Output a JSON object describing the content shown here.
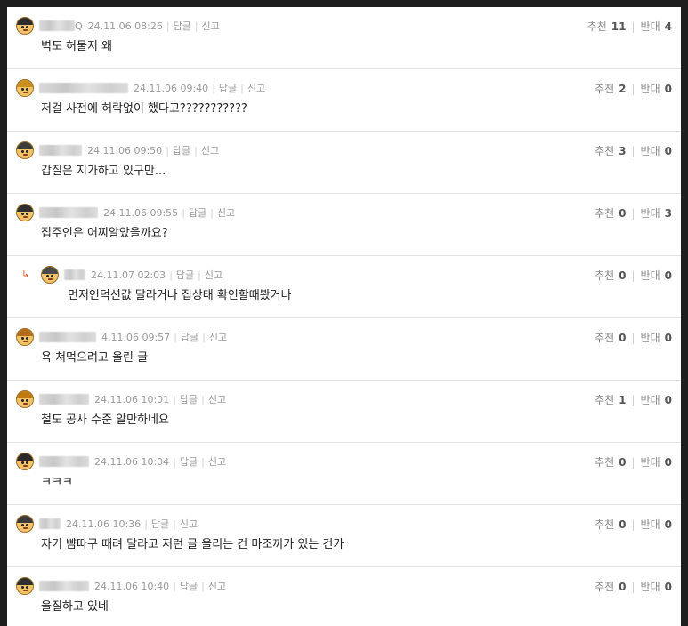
{
  "actions": {
    "reply": "답글",
    "report": "신고",
    "recommend": "추천",
    "oppose": "반대"
  },
  "reply_marker": "↳",
  "comments": [
    {
      "date": "24.11.06 08:26",
      "body": "벽도 허물지 왜",
      "up": "11",
      "down": "4",
      "reply": false,
      "hair": "#2b2b2b",
      "nick_w": 40,
      "nick_suffix": "Q"
    },
    {
      "date": "24.11.06 09:40",
      "body": "저걸 사전에 허락없이 했다고???????????",
      "up": "2",
      "down": "0",
      "reply": false,
      "hair": "#c9901e",
      "nick_w": 100,
      "nick_suffix": ""
    },
    {
      "date": "24.11.06 09:50",
      "body": "갑질은 지가하고 있구만...",
      "up": "3",
      "down": "0",
      "reply": false,
      "hair": "#3b3b3b",
      "nick_w": 48,
      "nick_suffix": ""
    },
    {
      "date": "24.11.06 09:55",
      "body": "집주인은 어찌알았을까요?",
      "up": "0",
      "down": "3",
      "reply": false,
      "hair": "#2f2f2f",
      "nick_w": 66,
      "nick_suffix": ""
    },
    {
      "date": "24.11.07 02:03",
      "body": "먼저인덕션값 달라거나 집상태 확인할때봤거나",
      "up": "0",
      "down": "0",
      "reply": true,
      "hair": "#4a4a4a",
      "nick_w": 24,
      "nick_suffix": ""
    },
    {
      "date": "4.11.06 09:57",
      "body": "욕 쳐먹으려고 올린 글",
      "up": "0",
      "down": "0",
      "reply": false,
      "hair": "#b36d1b",
      "nick_w": 64,
      "nick_suffix": ""
    },
    {
      "date": "24.11.06 10:01",
      "body": "철도 공사 수준 알만하네요",
      "up": "1",
      "down": "0",
      "reply": false,
      "hair": "#c07a12",
      "nick_w": 56,
      "nick_suffix": ""
    },
    {
      "date": "24.11.06 10:04",
      "body": "ㅋㅋㅋ",
      "up": "0",
      "down": "0",
      "reply": false,
      "hair": "#2a2a2a",
      "nick_w": 56,
      "nick_suffix": ""
    },
    {
      "date": "24.11.06 10:36",
      "body": "자기 뺨따구 때려 달라고 저런 글 올리는 건 마조끼가 있는 건가",
      "up": "0",
      "down": "0",
      "reply": false,
      "hair": "#3a3a3a",
      "nick_w": 24,
      "nick_suffix": ""
    },
    {
      "date": "24.11.06 10:40",
      "body": "을질하고 있네",
      "up": "0",
      "down": "0",
      "reply": false,
      "hair": "#2d2d2d",
      "nick_w": 56,
      "nick_suffix": ""
    }
  ]
}
